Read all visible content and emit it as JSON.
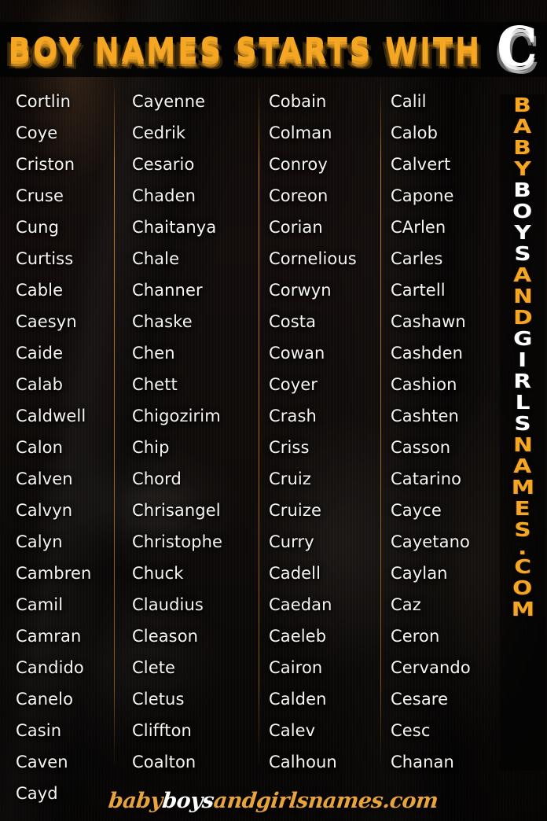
{
  "header": {
    "title": "BOY NAMES STARTS WITH",
    "letter": "C"
  },
  "colors": {
    "accent_orange": "#F5A623",
    "name_white": "#F7F5F2",
    "divider": "#C4802C",
    "background": "#130D0A"
  },
  "columns": [
    {
      "id": "column-1",
      "names": [
        "Cortlin",
        "Coye",
        "Criston",
        "Cruse",
        "Cung",
        "Curtiss",
        "Cable",
        "Caesyn",
        "Caide",
        "Calab",
        "Caldwell",
        "Calon",
        "Calven",
        "Calvyn",
        "Calyn",
        "Cambren",
        "Camil",
        "Camran",
        "Candido",
        "Canelo",
        "Casin",
        "Caven",
        "Cayd"
      ]
    },
    {
      "id": "column-2",
      "names": [
        "Cayenne",
        "Cedrik",
        "Cesario",
        "Chaden",
        "Chaitanya",
        "Chale",
        "Channer",
        "Chaske",
        "Chen",
        "Chett",
        "Chigozirim",
        "Chip",
        "Chord",
        "Chrisangel",
        "Christophe",
        "Chuck",
        "Claudius",
        "Cleason",
        "Clete",
        "Cletus",
        "Cliffton",
        "Coalton"
      ]
    },
    {
      "id": "column-3",
      "names": [
        "Cobain",
        "Colman",
        "Conroy",
        "Coreon",
        "Corian",
        "Cornelious",
        "Corwyn",
        "Costa",
        "Cowan",
        "Coyer",
        "Crash",
        "Criss",
        "Cruiz",
        "Cruize",
        "Curry",
        "Cadell",
        "Caedan",
        "Caeleb",
        "Cairon",
        "Calden",
        "Calev",
        "Calhoun"
      ]
    },
    {
      "id": "column-4",
      "names": [
        "Calil",
        "Calob",
        "Calvert",
        "Capone",
        "CArlen",
        "Carles",
        "Cartell",
        "Cashawn",
        "Cashden",
        "Cashion",
        "Cashten",
        "Casson",
        "Catarino",
        "Cayce",
        "Cayetano",
        "Caylan",
        "Caz",
        "Ceron",
        "Cervando",
        "Cesare",
        "Cesc",
        "Chanan"
      ]
    }
  ],
  "side_brand": {
    "segments": [
      {
        "text": "BABY",
        "color": "orange"
      },
      {
        "text": "BOYS",
        "color": "white"
      },
      {
        "text": "AND",
        "color": "orange"
      },
      {
        "text": "GIRLS",
        "color": "white"
      },
      {
        "text": "NAMES",
        "color": "orange"
      },
      {
        "text": ".COM",
        "color": "orange"
      }
    ]
  },
  "footer": {
    "watermark_parts": [
      {
        "text": "baby",
        "color": "orange"
      },
      {
        "text": "boys",
        "color": "white"
      },
      {
        "text": "andgirlsnames.com",
        "color": "orange"
      }
    ]
  }
}
